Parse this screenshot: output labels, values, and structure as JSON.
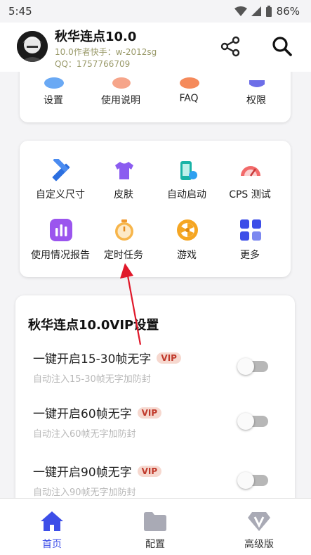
{
  "status": {
    "time": "5:45",
    "battery": "86%"
  },
  "header": {
    "title": "秋华连点10.0",
    "author": "10.0作者快手：w-2012sg",
    "qq": "QQ：1757766709"
  },
  "top_card": {
    "items": [
      {
        "label": "设置",
        "icon": "settings-icon"
      },
      {
        "label": "使用说明",
        "icon": "manual-icon"
      },
      {
        "label": "FAQ",
        "icon": "faq-icon"
      },
      {
        "label": "权限",
        "icon": "permission-icon"
      }
    ]
  },
  "tools": {
    "items": [
      {
        "label": "自定义尺寸",
        "icon": "ruler-pencil-icon"
      },
      {
        "label": "皮肤",
        "icon": "tshirt-icon"
      },
      {
        "label": "自动启动",
        "icon": "phone-launch-icon"
      },
      {
        "label": "CPS 测试",
        "icon": "speedometer-icon"
      },
      {
        "label": "使用情况报告",
        "icon": "bar-chart-icon"
      },
      {
        "label": "定时任务",
        "icon": "stopwatch-icon"
      },
      {
        "label": "游戏",
        "icon": "game-wheel-icon"
      },
      {
        "label": "更多",
        "icon": "more-grid-icon"
      }
    ]
  },
  "vip_settings": {
    "title": "秋华连点10.0VIP设置",
    "badge": "VIP",
    "options": [
      {
        "title": "一键开启15-30帧无字",
        "desc": "自动注入15-30帧无字加防封",
        "enabled": false
      },
      {
        "title": "一键开启60帧无字",
        "desc": "自动注入60帧无字加防封",
        "enabled": false
      },
      {
        "title": "一键开启90帧无字",
        "desc": "自动注入90帧无字加防封",
        "enabled": false
      }
    ]
  },
  "bottom_nav": {
    "items": [
      {
        "label": "首页",
        "icon": "home-icon",
        "active": true
      },
      {
        "label": "配置",
        "icon": "folder-icon",
        "active": false
      },
      {
        "label": "高级版",
        "icon": "diamond-v-icon",
        "active": false
      }
    ]
  },
  "colors": {
    "accent": "#3d4ee8",
    "vip_text": "#c0392b",
    "vip_bg": "#f6d8cf"
  }
}
